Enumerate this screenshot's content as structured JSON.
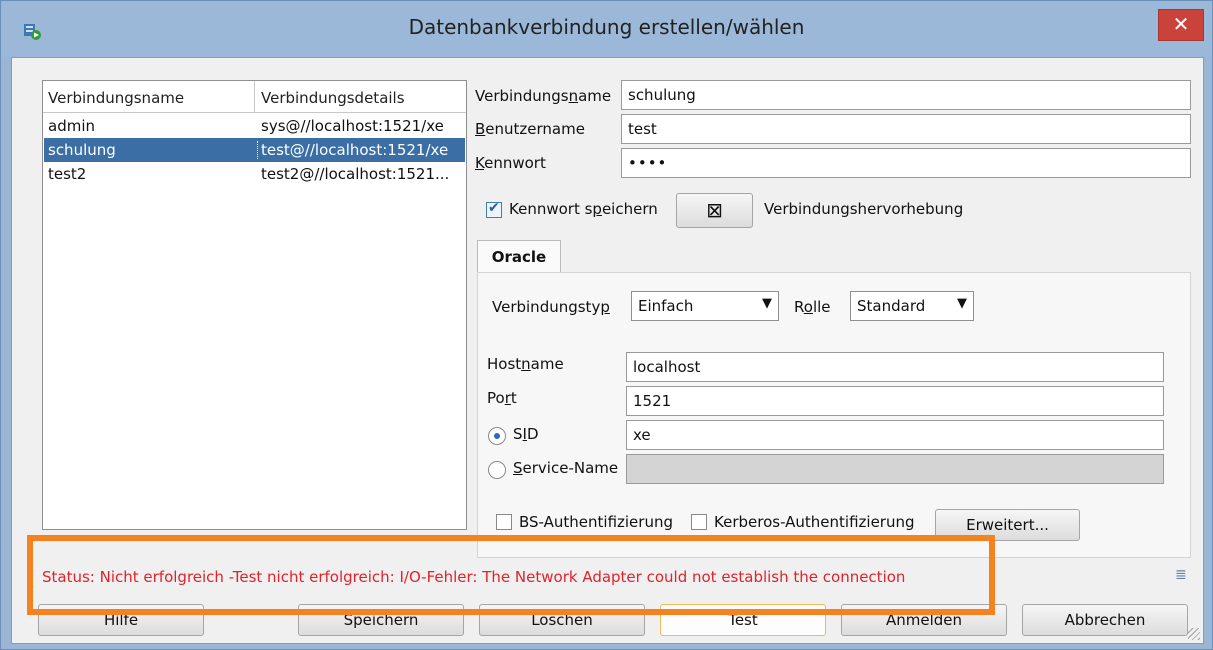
{
  "window": {
    "title": "Datenbankverbindung erstellen/wählen",
    "close_label": "✕"
  },
  "connections": {
    "headers": [
      "Verbindungsname",
      "Verbindungsdetails"
    ],
    "rows": [
      {
        "name": "admin",
        "details": "sys@//localhost:1521/xe"
      },
      {
        "name": "schulung",
        "details": "test@//localhost:1521/xe"
      },
      {
        "name": "test2",
        "details": "test2@//localhost:1521..."
      }
    ],
    "selected_index": 1
  },
  "form": {
    "name_label_pre": "Verbindungs",
    "name_label_ul": "n",
    "name_label_post": "ame",
    "name_value": "schulung",
    "user_label_ul": "B",
    "user_label_post": "enutzername",
    "user_value": "test",
    "pass_label_ul": "K",
    "pass_label_post": "ennwort",
    "pass_value": "••••",
    "save_pass_pre": "Kennwort s",
    "save_pass_ul": "p",
    "save_pass_post": "eichern",
    "highlight_label": "Verbindungshervorhebung",
    "highlight_glyph": "⊠"
  },
  "oracle": {
    "tab_label": "Oracle",
    "conntype_label_pre": "Verbindungsty",
    "conntype_label_ul": "p",
    "conntype_value": "Einfach",
    "role_label_pre": "R",
    "role_label_ul": "o",
    "role_label_post": "lle",
    "role_value": "Standard",
    "host_label_pre": "Host",
    "host_label_ul": "n",
    "host_label_post": "ame",
    "host_value": "localhost",
    "port_label_pre": "Po",
    "port_label_ul": "r",
    "port_label_post": "t",
    "port_value": "1521",
    "sid_label_pre": "S",
    "sid_label_ul": "I",
    "sid_label_post": "D",
    "sid_value": "xe",
    "service_label_ul": "S",
    "service_label_post": "ervice-Name",
    "service_value": "",
    "os_auth_label": "BS-Authentifizierung",
    "kerberos_label": "Kerberos-Authentifizierung",
    "advanced_label": "Erweitert..."
  },
  "status": {
    "text": "Status: Nicht erfolgreich -Test nicht erfolgreich: I/O-Fehler: The Network Adapter could not establish the connection",
    "list_icon": "≣"
  },
  "buttons": {
    "help": "Hilfe",
    "save": "Speichern",
    "delete": "Löschen",
    "test": "Test",
    "connect": "Anmelden",
    "cancel": "Abbrechen"
  },
  "colors": {
    "status_error": "#e0232b",
    "highlight_outline": "#f58220",
    "selection": "#3a6ea5"
  }
}
